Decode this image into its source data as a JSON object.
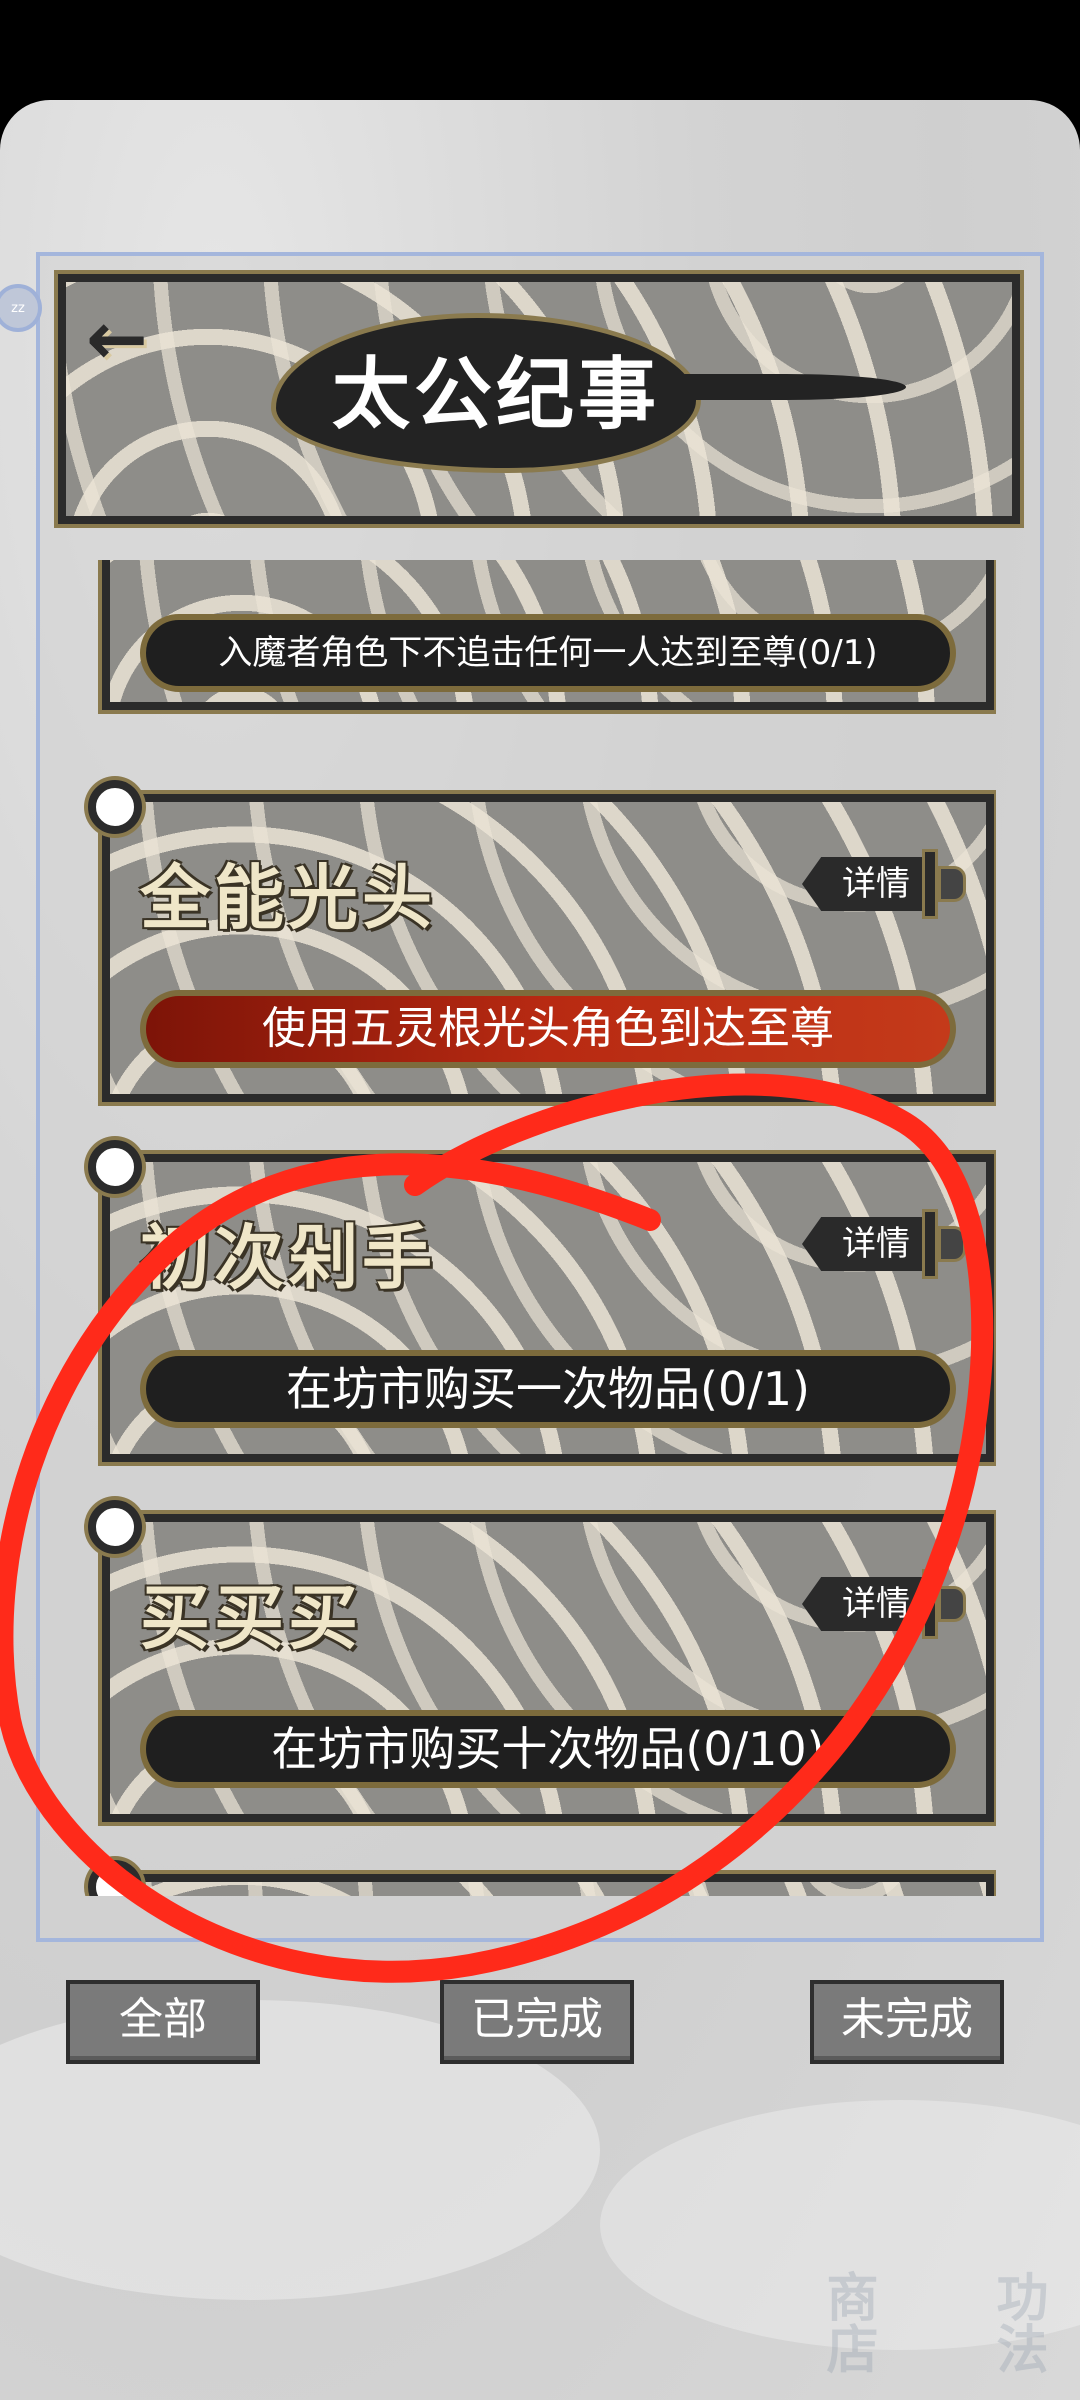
{
  "header": {
    "title": "太公纪事",
    "back_icon": "arrow-left-icon"
  },
  "cards": [
    {
      "title": "",
      "description": "入魔者角色下不追击任何一人达到至尊(0/1)",
      "completed": false,
      "has_detail": false
    },
    {
      "title": "全能光头",
      "detail_label": "详情",
      "description": "使用五灵根光头角色到达至尊",
      "completed": true
    },
    {
      "title": "初次剁手",
      "detail_label": "详情",
      "description": "在坊市购买一次物品(0/1)",
      "completed": false
    },
    {
      "title": "买买买",
      "detail_label": "详情",
      "description": "在坊市购买十次物品(0/10)",
      "completed": false
    }
  ],
  "tabs": [
    {
      "label": "全部"
    },
    {
      "label": "已完成"
    },
    {
      "label": "未完成"
    }
  ],
  "background_labels": {
    "shop": "商店",
    "method": "功法"
  },
  "colors": {
    "completed_bar": "#b82a12",
    "annotation": "#ff2a1a",
    "frame": "#2b2b2b",
    "gold_trim": "#8a7a4e"
  }
}
